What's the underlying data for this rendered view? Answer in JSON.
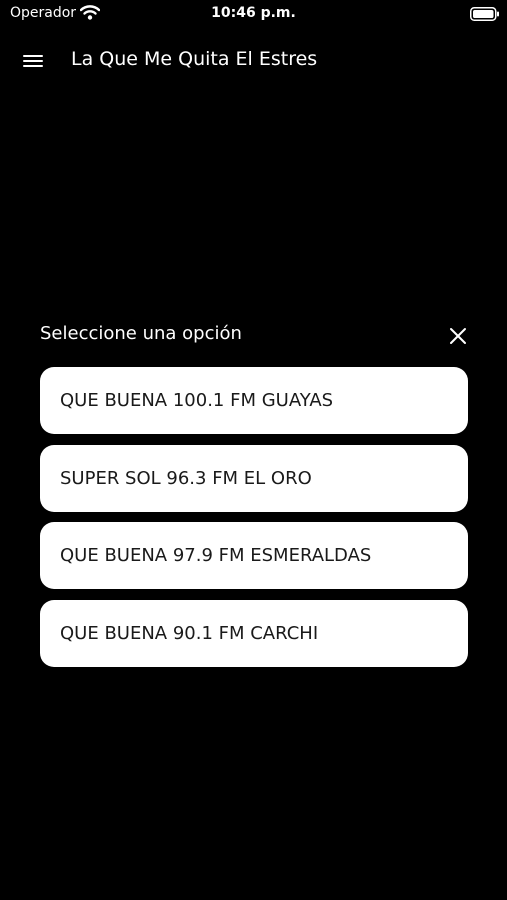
{
  "status_bar": {
    "carrier": "Operador",
    "time": "10:46 p.m.",
    "wifi_icon": "wifi-icon",
    "battery_icon": "battery-icon"
  },
  "app_bar": {
    "menu_icon": "hamburger-menu-icon",
    "title": "La Que Me Quita El Estres"
  },
  "dialog": {
    "title": "Seleccione una opción",
    "close_icon": "close-icon",
    "options": [
      {
        "label": "QUE BUENA 100.1 FM GUAYAS"
      },
      {
        "label": "SUPER SOL 96.3 FM EL ORO"
      },
      {
        "label": "QUE BUENA 97.9 FM ESMERALDAS"
      },
      {
        "label": "QUE BUENA 90.1 FM CARCHI"
      }
    ]
  },
  "colors": {
    "background": "#000000",
    "text_on_dark": "#ffffff",
    "option_background": "#ffffff",
    "option_text": "#1a1a1a"
  }
}
